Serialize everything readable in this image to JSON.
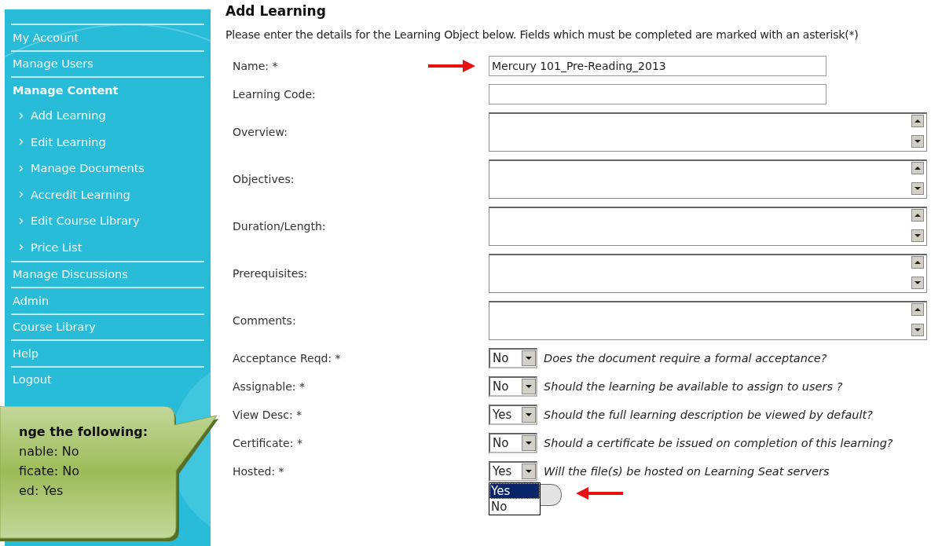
{
  "sidebar": {
    "items": [
      {
        "label": "My Account",
        "kind": "top"
      },
      {
        "label": "Manage Users",
        "kind": "top"
      },
      {
        "label": "Manage Content",
        "kind": "heading"
      },
      {
        "label": "Add Learning",
        "kind": "sub"
      },
      {
        "label": "Edit Learning",
        "kind": "sub"
      },
      {
        "label": "Manage Documents",
        "kind": "sub"
      },
      {
        "label": "Accredit Learning",
        "kind": "sub"
      },
      {
        "label": "Edit Course Library",
        "kind": "sub"
      },
      {
        "label": "Price List",
        "kind": "sub"
      },
      {
        "label": "Manage Discussions",
        "kind": "top"
      },
      {
        "label": "Admin",
        "kind": "top"
      },
      {
        "label": "Course Library",
        "kind": "top"
      },
      {
        "label": "Help",
        "kind": "top"
      },
      {
        "label": "Logout",
        "kind": "top"
      }
    ]
  },
  "callout": {
    "heading": "nge the following:",
    "lines": [
      "nable: No",
      "ficate: No",
      "ed: Yes"
    ]
  },
  "form": {
    "title": "Add Learning",
    "intro": "Please enter the details for the Learning Object below. Fields which must be completed are marked with an asterisk(*)",
    "fields": [
      {
        "label": "Name: *",
        "kind": "text",
        "value": "Mercury 101_Pre-Reading_2013",
        "arrow": true
      },
      {
        "label": "Learning Code:",
        "kind": "text"
      },
      {
        "label": "Overview:",
        "kind": "textarea"
      },
      {
        "label": "Objectives:",
        "kind": "textarea"
      },
      {
        "label": "Duration/Length:",
        "kind": "textarea"
      },
      {
        "label": "Prerequisites:",
        "kind": "textarea"
      },
      {
        "label": "Comments:",
        "kind": "textarea"
      },
      {
        "label": "Acceptance Reqd: *",
        "kind": "select",
        "value": "No",
        "hint": "Does the document require a formal acceptance?"
      },
      {
        "label": "Assignable: *",
        "kind": "select",
        "value": "No",
        "hint": "Should the learning be available to assign to users ?"
      },
      {
        "label": "View Desc: *",
        "kind": "select",
        "value": "Yes",
        "hint": "Should the full learning description be viewed by default?"
      },
      {
        "label": "Certificate: *",
        "kind": "select",
        "value": "No",
        "hint": "Should a certificate be issued on completion of this learning?"
      },
      {
        "label": "Hosted: *",
        "kind": "select",
        "value": "Yes",
        "hint": "Will the file(s) be hosted on Learning Seat servers",
        "open": true,
        "options": [
          {
            "label": "Yes",
            "selected": true
          },
          {
            "label": "No",
            "selected": false
          }
        ]
      }
    ]
  }
}
